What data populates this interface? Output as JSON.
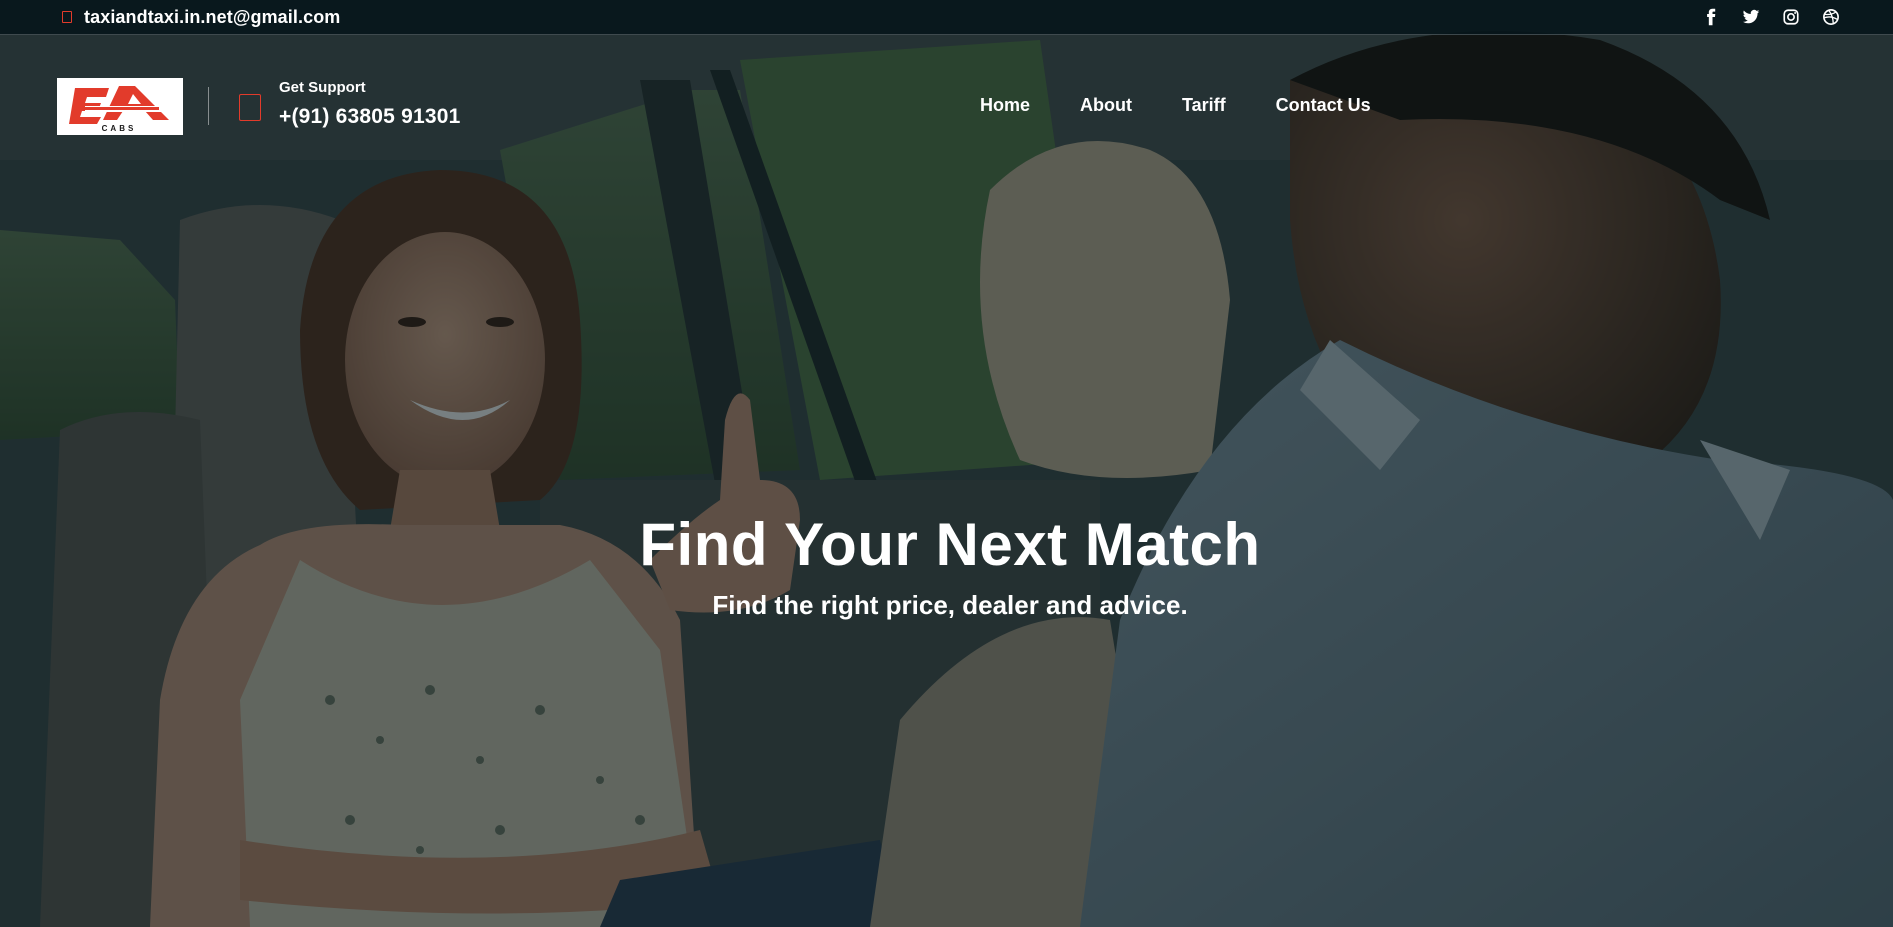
{
  "topbar": {
    "email": "taxiandtaxi.in.net@gmail.com",
    "social": [
      {
        "name": "facebook-icon"
      },
      {
        "name": "twitter-icon"
      },
      {
        "name": "instagram-icon"
      },
      {
        "name": "dribbble-icon"
      }
    ]
  },
  "header": {
    "logo": {
      "main": "EA",
      "sub": "CABS"
    },
    "support_label": "Get Support",
    "support_phone": "+(91) 63805 91301",
    "nav": [
      "Home",
      "About",
      "Tariff",
      "Contact Us"
    ]
  },
  "hero": {
    "title": "Find Your Next Match",
    "subtitle": "Find the right price, dealer and advice."
  },
  "colors": {
    "accent": "#e23b2b",
    "topbar_bg": "#06161b",
    "overlay": "#08161a",
    "text": "#ffffff"
  }
}
